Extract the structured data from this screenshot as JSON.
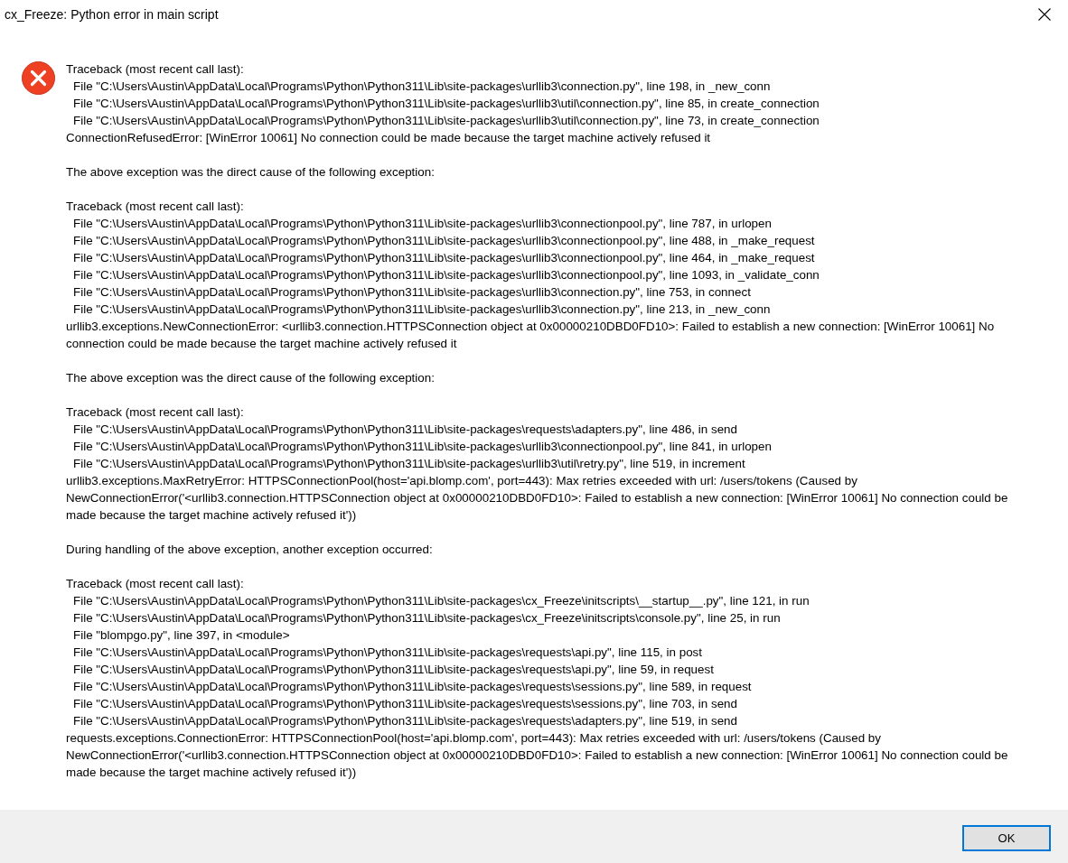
{
  "window": {
    "title": "cx_Freeze: Python error in main script"
  },
  "message": {
    "paragraphs": [
      {
        "lines": [
          {
            "kind": "header",
            "text": "Traceback (most recent call last):"
          },
          {
            "kind": "frame",
            "text": "File \"C:\\Users\\Austin\\AppData\\Local\\Programs\\Python\\Python311\\Lib\\site-packages\\urllib3\\connection.py\", line 198, in _new_conn"
          },
          {
            "kind": "frame",
            "text": "File \"C:\\Users\\Austin\\AppData\\Local\\Programs\\Python\\Python311\\Lib\\site-packages\\urllib3\\util\\connection.py\", line 85, in create_connection"
          },
          {
            "kind": "frame",
            "text": "File \"C:\\Users\\Austin\\AppData\\Local\\Programs\\Python\\Python311\\Lib\\site-packages\\urllib3\\util\\connection.py\", line 73, in create_connection"
          },
          {
            "kind": "error",
            "text": "ConnectionRefusedError: [WinError 10061] No connection could be made because the target machine actively refused it"
          }
        ]
      },
      {
        "lines": [
          {
            "kind": "note",
            "text": "The above exception was the direct cause of the following exception:"
          }
        ]
      },
      {
        "lines": [
          {
            "kind": "header",
            "text": "Traceback (most recent call last):"
          },
          {
            "kind": "frame",
            "text": "File \"C:\\Users\\Austin\\AppData\\Local\\Programs\\Python\\Python311\\Lib\\site-packages\\urllib3\\connectionpool.py\", line 787, in urlopen"
          },
          {
            "kind": "frame",
            "text": "File \"C:\\Users\\Austin\\AppData\\Local\\Programs\\Python\\Python311\\Lib\\site-packages\\urllib3\\connectionpool.py\", line 488, in _make_request"
          },
          {
            "kind": "frame",
            "text": "File \"C:\\Users\\Austin\\AppData\\Local\\Programs\\Python\\Python311\\Lib\\site-packages\\urllib3\\connectionpool.py\", line 464, in _make_request"
          },
          {
            "kind": "frame",
            "text": "File \"C:\\Users\\Austin\\AppData\\Local\\Programs\\Python\\Python311\\Lib\\site-packages\\urllib3\\connectionpool.py\", line 1093, in _validate_conn"
          },
          {
            "kind": "frame",
            "text": "File \"C:\\Users\\Austin\\AppData\\Local\\Programs\\Python\\Python311\\Lib\\site-packages\\urllib3\\connection.py\", line 753, in connect"
          },
          {
            "kind": "frame",
            "text": "File \"C:\\Users\\Austin\\AppData\\Local\\Programs\\Python\\Python311\\Lib\\site-packages\\urllib3\\connection.py\", line 213, in _new_conn"
          },
          {
            "kind": "error",
            "text": "urllib3.exceptions.NewConnectionError: <urllib3.connection.HTTPSConnection object at 0x00000210DBD0FD10>: Failed to establish a new connection: [WinError 10061] No connection could be made because the target machine actively refused it"
          }
        ]
      },
      {
        "lines": [
          {
            "kind": "note",
            "text": "The above exception was the direct cause of the following exception:"
          }
        ]
      },
      {
        "lines": [
          {
            "kind": "header",
            "text": "Traceback (most recent call last):"
          },
          {
            "kind": "frame",
            "text": "File \"C:\\Users\\Austin\\AppData\\Local\\Programs\\Python\\Python311\\Lib\\site-packages\\requests\\adapters.py\", line 486, in send"
          },
          {
            "kind": "frame",
            "text": "File \"C:\\Users\\Austin\\AppData\\Local\\Programs\\Python\\Python311\\Lib\\site-packages\\urllib3\\connectionpool.py\", line 841, in urlopen"
          },
          {
            "kind": "frame",
            "text": "File \"C:\\Users\\Austin\\AppData\\Local\\Programs\\Python\\Python311\\Lib\\site-packages\\urllib3\\util\\retry.py\", line 519, in increment"
          },
          {
            "kind": "error",
            "text": "urllib3.exceptions.MaxRetryError: HTTPSConnectionPool(host='api.blomp.com', port=443): Max retries exceeded with url: /users/tokens (Caused by NewConnectionError('<urllib3.connection.HTTPSConnection object at 0x00000210DBD0FD10>: Failed to establish a new connection: [WinError 10061] No connection could be made because the target machine actively refused it'))"
          }
        ]
      },
      {
        "lines": [
          {
            "kind": "note",
            "text": "During handling of the above exception, another exception occurred:"
          }
        ]
      },
      {
        "lines": [
          {
            "kind": "header",
            "text": "Traceback (most recent call last):"
          },
          {
            "kind": "frame",
            "text": "File \"C:\\Users\\Austin\\AppData\\Local\\Programs\\Python\\Python311\\Lib\\site-packages\\cx_Freeze\\initscripts\\__startup__.py\", line 121, in run"
          },
          {
            "kind": "frame",
            "text": "File \"C:\\Users\\Austin\\AppData\\Local\\Programs\\Python\\Python311\\Lib\\site-packages\\cx_Freeze\\initscripts\\console.py\", line 25, in run"
          },
          {
            "kind": "frame",
            "text": "File \"blompgo.py\", line 397, in <module>"
          },
          {
            "kind": "frame",
            "text": "File \"C:\\Users\\Austin\\AppData\\Local\\Programs\\Python\\Python311\\Lib\\site-packages\\requests\\api.py\", line 115, in post"
          },
          {
            "kind": "frame",
            "text": "File \"C:\\Users\\Austin\\AppData\\Local\\Programs\\Python\\Python311\\Lib\\site-packages\\requests\\api.py\", line 59, in request"
          },
          {
            "kind": "frame",
            "text": "File \"C:\\Users\\Austin\\AppData\\Local\\Programs\\Python\\Python311\\Lib\\site-packages\\requests\\sessions.py\", line 589, in request"
          },
          {
            "kind": "frame",
            "text": "File \"C:\\Users\\Austin\\AppData\\Local\\Programs\\Python\\Python311\\Lib\\site-packages\\requests\\sessions.py\", line 703, in send"
          },
          {
            "kind": "frame",
            "text": "File \"C:\\Users\\Austin\\AppData\\Local\\Programs\\Python\\Python311\\Lib\\site-packages\\requests\\adapters.py\", line 519, in send"
          },
          {
            "kind": "error",
            "text": "requests.exceptions.ConnectionError: HTTPSConnectionPool(host='api.blomp.com', port=443): Max retries exceeded with url: /users/tokens (Caused by NewConnectionError('<urllib3.connection.HTTPSConnection object at 0x00000210DBD0FD10>: Failed to establish a new connection: [WinError 10061] No connection could be made because the target machine actively refused it'))"
          }
        ]
      }
    ]
  },
  "buttons": [
    {
      "label": "OK",
      "selected": true
    }
  ]
}
